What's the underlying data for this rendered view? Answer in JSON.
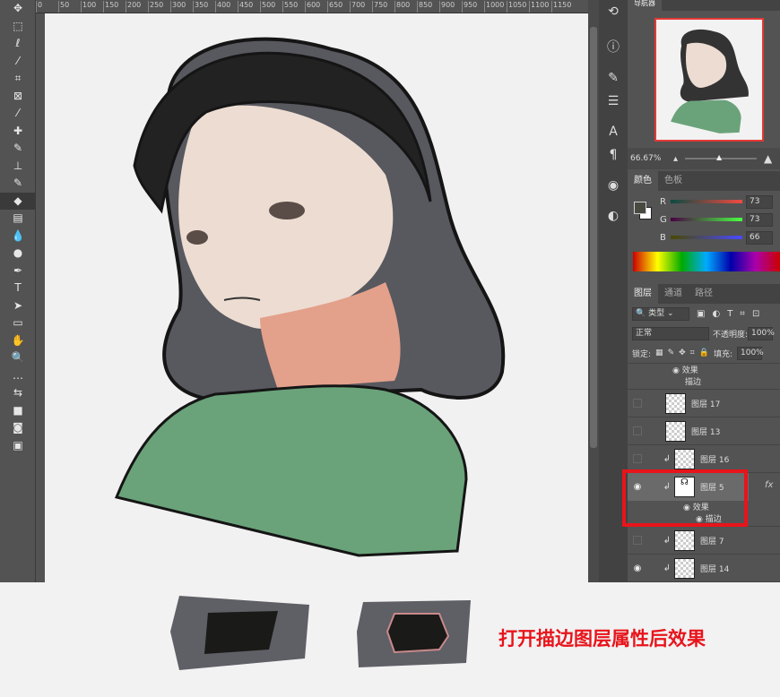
{
  "ruler": {
    "ticks": [
      "0",
      "50",
      "100",
      "150",
      "200",
      "250",
      "300",
      "350",
      "400",
      "450",
      "500",
      "550",
      "600",
      "650",
      "700",
      "750",
      "800",
      "850",
      "900",
      "950",
      "1000",
      "1050",
      "1100",
      "1150"
    ]
  },
  "toolbar": {
    "tools": [
      "move",
      "marquee",
      "lasso",
      "magic-wand",
      "crop",
      "frame",
      "eyedropper",
      "healing",
      "brush",
      "stamp",
      "history-brush",
      "eraser",
      "gradient",
      "blur",
      "dodge",
      "pen",
      "type",
      "path-select",
      "rectangle",
      "hand",
      "zoom",
      "more",
      "swap-colors",
      "colors",
      "quick-mask",
      "screen-mode"
    ]
  },
  "navigator": {
    "tab": "导航器",
    "zoom": "66.67%"
  },
  "color_panel": {
    "tabs": [
      "颜色",
      "色板"
    ],
    "r_label": "R",
    "g_label": "G",
    "b_label": "B",
    "r": "73",
    "g": "73",
    "b": "66",
    "fg_color": "#494942"
  },
  "layers_panel": {
    "tabs": [
      "图层",
      "通道",
      "路径"
    ],
    "filter": "类型",
    "blend_mode": "正常",
    "opacity_label": "不透明度:",
    "opacity": "100%",
    "lock_label": "锁定:",
    "fill_label": "填充:",
    "fill": "100%",
    "top_effects": "效果",
    "top_stroke": "描边",
    "layers": [
      {
        "name": "图层 17",
        "visible": false,
        "clipped": false
      },
      {
        "name": "图层 13",
        "visible": false,
        "clipped": false
      },
      {
        "name": "图层 16",
        "visible": false,
        "clipped": true
      },
      {
        "name": "图层 5",
        "visible": true,
        "clipped": true,
        "selected": true,
        "fx": "fx",
        "effects": "效果",
        "stroke": "描边"
      },
      {
        "name": "图层 7",
        "visible": false,
        "clipped": true
      },
      {
        "name": "图层 14",
        "visible": true,
        "clipped": true
      }
    ]
  },
  "caption": "打开描边图层属性后效果",
  "colors": {
    "accent_red": "#e8141b",
    "sweater": "#6aa37a",
    "hair": "#1e1e1e"
  }
}
